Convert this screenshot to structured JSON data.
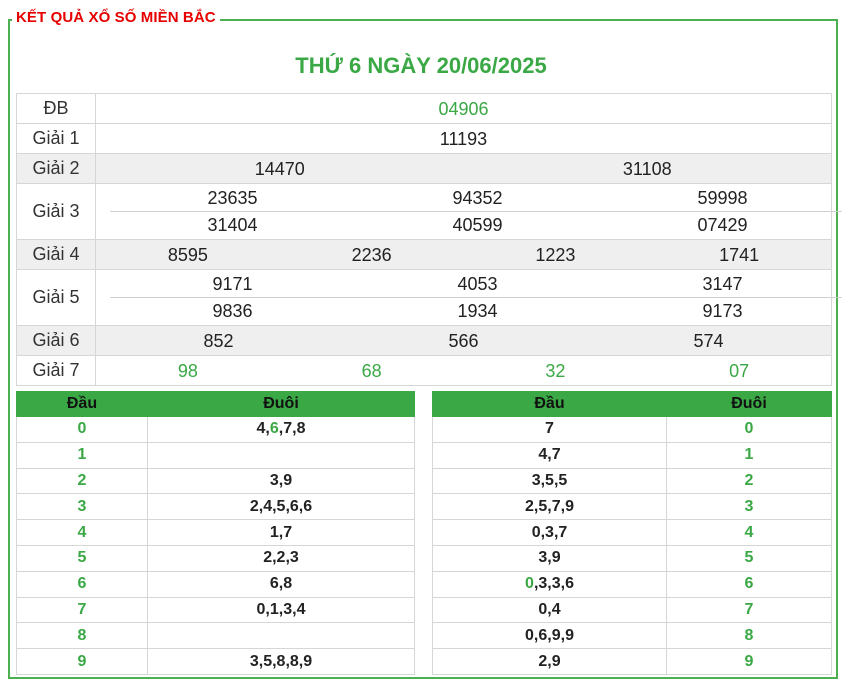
{
  "header": {
    "title": "KẾT QUẢ XỔ SỐ MIỀN BẮC",
    "date": "THỨ 6 NGÀY 20/06/2025"
  },
  "prizes": [
    {
      "label": "ĐB",
      "rows": [
        [
          "04906"
        ]
      ]
    },
    {
      "label": "Giải 1",
      "rows": [
        [
          "11193"
        ]
      ]
    },
    {
      "label": "Giải 2",
      "rows": [
        [
          "14470",
          "31108"
        ]
      ]
    },
    {
      "label": "Giải 3",
      "rows": [
        [
          "23635",
          "94352",
          "59998"
        ],
        [
          "31404",
          "40599",
          "07429"
        ]
      ]
    },
    {
      "label": "Giải 4",
      "rows": [
        [
          "8595",
          "2236",
          "1223",
          "1741"
        ]
      ]
    },
    {
      "label": "Giải 5",
      "rows": [
        [
          "9171",
          "4053",
          "3147"
        ],
        [
          "9836",
          "1934",
          "9173"
        ]
      ]
    },
    {
      "label": "Giải 6",
      "rows": [
        [
          "852",
          "566",
          "574"
        ]
      ]
    },
    {
      "label": "Giải 7",
      "rows": [
        [
          "98",
          "68",
          "32",
          "07"
        ]
      ]
    }
  ],
  "loto_head": {
    "col_head": "Đầu",
    "col_tail": "Đuôi",
    "rows": [
      {
        "num": "0",
        "vals": [
          "4,",
          "6",
          ",7,8"
        ]
      },
      {
        "num": "1",
        "vals": [
          "",
          "",
          ""
        ]
      },
      {
        "num": "2",
        "vals": [
          "3,9",
          "",
          ""
        ]
      },
      {
        "num": "3",
        "vals": [
          "2,4,5,6,6",
          "",
          ""
        ]
      },
      {
        "num": "4",
        "vals": [
          "1,7",
          "",
          ""
        ]
      },
      {
        "num": "5",
        "vals": [
          "2,2,3",
          "",
          ""
        ]
      },
      {
        "num": "6",
        "vals": [
          "6,8",
          "",
          ""
        ]
      },
      {
        "num": "7",
        "vals": [
          "0,1,3,4",
          "",
          ""
        ]
      },
      {
        "num": "8",
        "vals": [
          "",
          "",
          ""
        ]
      },
      {
        "num": "9",
        "vals": [
          "3,5,8,8,9",
          "",
          ""
        ]
      }
    ]
  },
  "loto_tail": {
    "col_head": "Đầu",
    "col_tail": "Đuôi",
    "rows": [
      {
        "num": "0",
        "vals": [
          "",
          "",
          "7"
        ]
      },
      {
        "num": "1",
        "vals": [
          "",
          "",
          "4,7"
        ]
      },
      {
        "num": "2",
        "vals": [
          "",
          "",
          "3,5,5"
        ]
      },
      {
        "num": "3",
        "vals": [
          "",
          "",
          "2,5,7,9"
        ]
      },
      {
        "num": "4",
        "vals": [
          "",
          "",
          "0,3,7"
        ]
      },
      {
        "num": "5",
        "vals": [
          "",
          "",
          "3,9"
        ]
      },
      {
        "num": "6",
        "vals": [
          "",
          "0",
          ",3,3,6"
        ]
      },
      {
        "num": "7",
        "vals": [
          "",
          "",
          "0,4"
        ]
      },
      {
        "num": "8",
        "vals": [
          "",
          "",
          "0,6,9,9"
        ]
      },
      {
        "num": "9",
        "vals": [
          "",
          "",
          "2,9"
        ]
      }
    ]
  },
  "colors": {
    "accent_green": "#3aa845",
    "title_red": "#e60000",
    "border_green": "#4caf50"
  }
}
